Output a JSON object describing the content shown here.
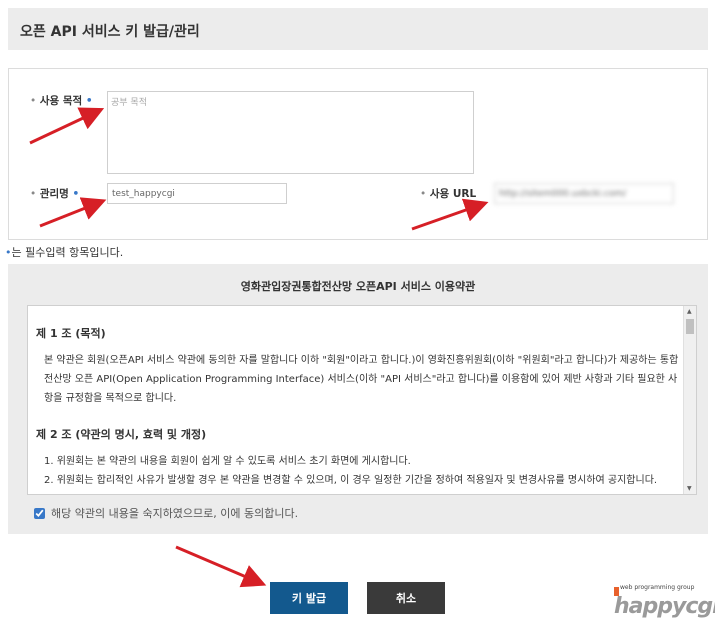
{
  "page": {
    "title": "오픈 API 서비스 키 발급/관리"
  },
  "form": {
    "purpose": {
      "label": "사용 목적",
      "placeholder": "공부 목적"
    },
    "manager": {
      "label": "관리명",
      "value": "test_happycgi"
    },
    "url": {
      "label": "사용 URL",
      "value": "http://sitem000.uxbcki.com/"
    },
    "required_marker": "•",
    "bullet": "•"
  },
  "required_note": "는 필수입력 항목입니다.",
  "terms": {
    "title": "영화관입장권통합전산망 오픈API 서비스 이용약관",
    "article1": {
      "title": "제 1 조 (목적)",
      "body": "본 약관은 회원(오픈API 서비스 약관에 동의한 자를 말합니다 이하 \"회원\"이라고 합니다.)이 영화진흥위원회(이하 \"위원회\"라고 합니다)가 제공하는 통합전산망 오픈 API(Open Application Programming Interface) 서비스(이하 \"API 서비스\"라고 합니다)를 이용함에 있어 제반 사항과 기타 필요한 사항을 규정함을 목적으로 합니다."
    },
    "article2": {
      "title": "제 2 조 (약관의 명시, 효력 및 개정)",
      "items": [
        "1. 위원회는 본 약관의 내용을 회원이 쉽게 알 수 있도록 서비스 초기 화면에 게시합니다.",
        "2. 위원회는 합리적인 사유가 발생할 경우 본 약관을 변경할 수 있으며, 이 경우 일정한 기간을 정하여 적용일자 및 변경사유를 명시하여 공지합니다."
      ]
    },
    "agree_label": "해당 약관의 내용을 숙지하였으므로, 이에 동의합니다.",
    "agree_checked": true
  },
  "buttons": {
    "issue": "키 발급",
    "cancel": "취소"
  },
  "logo": {
    "small": "web programming group",
    "big": "happycgi"
  },
  "colors": {
    "accent": "#13598e",
    "required": "#3878c8",
    "arrow": "#d61f26",
    "cancel": "#3a3a3a"
  }
}
